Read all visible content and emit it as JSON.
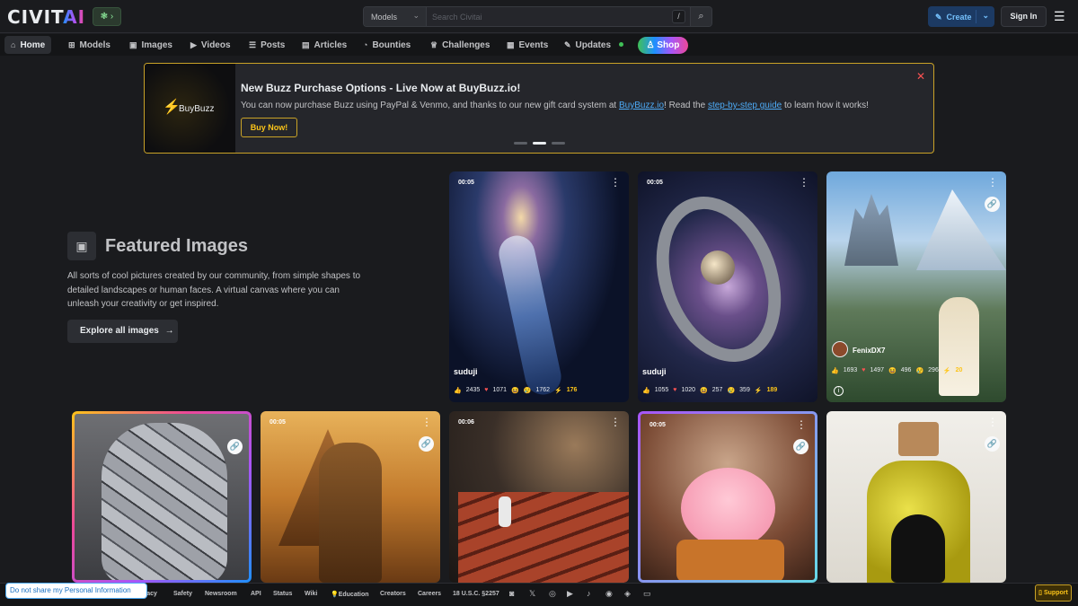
{
  "header": {
    "logo_main": "CIVIT",
    "logo_ai": "AI",
    "badge": "❃ ›",
    "search_type": "Models",
    "search_placeholder": "Search Civitai",
    "slash": "/",
    "create_label": "Create",
    "signin_label": "Sign In"
  },
  "nav": {
    "items": [
      {
        "label": "Home",
        "icon": "⌂"
      },
      {
        "label": "Models",
        "icon": "⊞"
      },
      {
        "label": "Images",
        "icon": "▣"
      },
      {
        "label": "Videos",
        "icon": "▶"
      },
      {
        "label": "Posts",
        "icon": "☰"
      },
      {
        "label": "Articles",
        "icon": "▤"
      },
      {
        "label": "Bounties",
        "icon": "◔"
      },
      {
        "label": "Challenges",
        "icon": "♕"
      },
      {
        "label": "Events",
        "icon": "▦"
      },
      {
        "label": "Updates",
        "icon": "✎"
      }
    ],
    "shop_label": "Shop",
    "shop_icon": "♙"
  },
  "banner": {
    "image_text": "BuyBuzz",
    "title": "New Buzz Purchase Options - Live Now at BuyBuzz.io!",
    "text_1": "You can now purchase Buzz using PayPal & Venmo, and thanks to our new gift card system at ",
    "link_1": "BuyBuzz.io",
    "text_2": "! Read the ",
    "link_2": "step-by-step guide",
    "text_3": " to learn how it works!",
    "button": "Buy Now!",
    "close": "✕"
  },
  "featured": {
    "title": "Featured Images",
    "description": "All sorts of cool pictures created by our community, from simple shapes to detailed landscapes or human faces. A virtual canvas where you can unleash your creativity or get inspired.",
    "explore_label": "Explore all images",
    "explore_arrow": "→"
  },
  "cards": [
    {
      "duration": "00:05",
      "user": "suduji",
      "likes": "2435",
      "hearts": "1071",
      "laughs": "",
      "cries": "1762",
      "buzz": "176"
    },
    {
      "duration": "00:05",
      "user": "suduji",
      "likes": "1055",
      "hearts": "1020",
      "laughs": "257",
      "cries": "359",
      "buzz": "189"
    },
    {
      "duration": "",
      "user": "FenixDX7",
      "likes": "1693",
      "hearts": "1497",
      "laughs": "496",
      "cries": "296",
      "buzz": "20"
    },
    {
      "duration": ""
    },
    {
      "duration": "00:05"
    },
    {
      "duration": "00:06"
    },
    {
      "duration": "00:05"
    },
    {
      "duration": ""
    }
  ],
  "footer": {
    "do_not_share": "Do not share my Personal Information",
    "links": [
      "Privacy",
      "Safety",
      "Newsroom",
      "API",
      "Status",
      "Wiki",
      "💡Education",
      "Creators",
      "Careers",
      "18 U.S.C. §2257"
    ],
    "support": "Support",
    "support_icon": "▯"
  }
}
